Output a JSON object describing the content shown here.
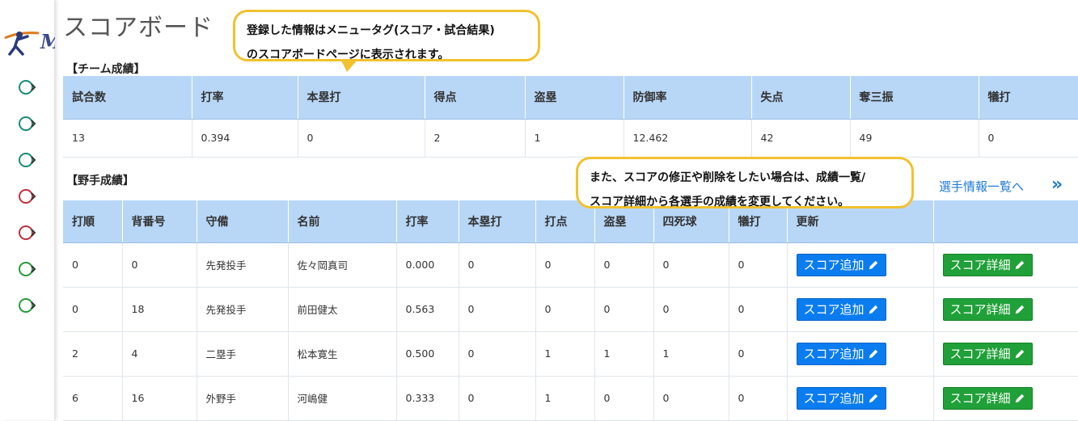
{
  "app": {
    "logo_text": "M",
    "nav_colors": [
      "#1a8a7a",
      "#1a8a7a",
      "#1a8a7a",
      "#c0303c",
      "#c0303c",
      "#2a9a3a",
      "#2a9a3a"
    ],
    "nav_icon": "chevron-circle-icon"
  },
  "page": {
    "title": "スコアボード"
  },
  "callouts": [
    {
      "line1": "登録した情報はメニュータグ(スコア・試合結果)",
      "line2": "のスコアボードページに表示されます。"
    },
    {
      "line1": "また、スコアの修正や削除をしたい場合は、成績一覧/",
      "line2": "スコア詳細から各選手の成績を変更してください。"
    }
  ],
  "team": {
    "section_label": "【チーム成績】",
    "headers": [
      "試合数",
      "打率",
      "本塁打",
      "得点",
      "盗塁",
      "防御率",
      "失点",
      "奪三振",
      "犠打"
    ],
    "values": [
      "13",
      "0.394",
      "0",
      "2",
      "1",
      "12.462",
      "42",
      "49",
      "0"
    ]
  },
  "players": {
    "section_label": "【野手成績】",
    "link_label": "選手情報一覧へ",
    "link_arrow": "»",
    "headers": [
      "打順",
      "背番号",
      "守備",
      "名前",
      "打率",
      "本塁打",
      "打点",
      "盗塁",
      "四死球",
      "犠打",
      "更新",
      ""
    ],
    "add_label": "スコア追加",
    "detail_label": "スコア詳細",
    "rows": [
      [
        "0",
        "0",
        "先発投手",
        "佐々岡真司",
        "0.000",
        "0",
        "0",
        "0",
        "0",
        "0"
      ],
      [
        "0",
        "18",
        "先発投手",
        "前田健太",
        "0.563",
        "0",
        "0",
        "0",
        "0",
        "0"
      ],
      [
        "2",
        "4",
        "二塁手",
        "松本寛生",
        "0.500",
        "0",
        "1",
        "1",
        "1",
        "0"
      ],
      [
        "6",
        "16",
        "外野手",
        "河嶋健",
        "0.333",
        "0",
        "1",
        "0",
        "0",
        "0"
      ]
    ]
  },
  "colors": {
    "header_bg": "#b8d7f7",
    "btn_blue": "#0a7cf0",
    "btn_green": "#20a038",
    "callout_border": "#f2c12e",
    "link": "#1f7ad6"
  }
}
